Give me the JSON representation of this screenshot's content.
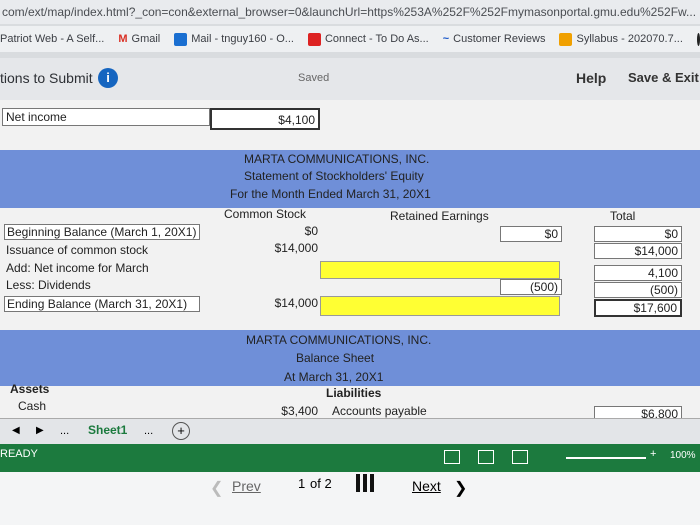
{
  "browser": {
    "url": "com/ext/map/index.html?_con=con&external_browser=0&launchUrl=https%253A%252F%252Fmymasonportal.gmu.edu%252Fw...",
    "bookmarks": [
      "Patriot Web - A Self...",
      "Gmail",
      "Mail - tnguy160 - O...",
      "Connect - To Do As...",
      "Customer Reviews",
      "Syllabus - 202070.7..."
    ]
  },
  "app": {
    "title": "tions to Submit",
    "saved_label": "Saved",
    "help_label": "Help",
    "save_exit_label": "Save & Exit"
  },
  "sheet": {
    "net_income_label": "Net income",
    "net_income_value": "$4,100",
    "equity": {
      "company": "MARTA COMMUNICATIONS, INC.",
      "statement": "Statement of Stockholders' Equity",
      "period": "For the Month Ended March 31, 20X1",
      "col_common": "Common Stock",
      "col_retained": "Retained Earnings",
      "col_total": "Total",
      "rows": [
        {
          "label": "Beginning Balance (March 1, 20X1)",
          "common": "$0",
          "retained": "$0",
          "total": "$0"
        },
        {
          "label": "Issuance of common stock",
          "common": "$14,000",
          "retained": "",
          "total": "$14,000"
        },
        {
          "label": "Add: Net income for March",
          "common": "",
          "retained": "",
          "total": "4,100"
        },
        {
          "label": "Less: Dividends",
          "common": "",
          "retained": "(500)",
          "total": "(500)"
        },
        {
          "label": "Ending Balance (March 31, 20X1)",
          "common": "$14,000",
          "retained": "",
          "total": "$17,600"
        }
      ]
    },
    "balance": {
      "company": "MARTA COMMUNICATIONS, INC.",
      "statement": "Balance Sheet",
      "date": "At March 31, 20X1",
      "assets_label": "Assets",
      "liabilities_label": "Liabilities",
      "cash_label": "Cash",
      "cash_value": "$3,400",
      "accounts_payable_label": "Accounts payable",
      "accounts_payable_value": "$6,800"
    }
  },
  "tabs": {
    "more1": "...",
    "active": "Sheet1",
    "more2": "..."
  },
  "status": {
    "ready": "READY",
    "zoom": "100%"
  },
  "pager": {
    "prev": "Prev",
    "current": "1",
    "of": "of 2",
    "next": "Next"
  }
}
